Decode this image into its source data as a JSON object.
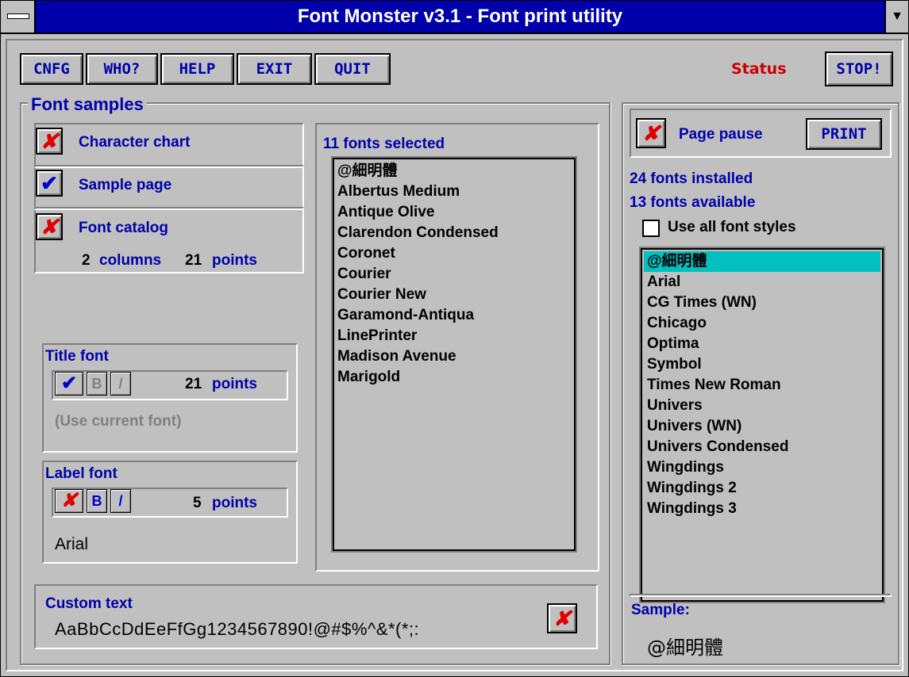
{
  "window": {
    "title": "Font Monster v3.1 - Font print utility"
  },
  "toolbar": {
    "buttons": [
      "CNFG",
      "WHO?",
      "HELP",
      "EXIT",
      "QUIT"
    ],
    "status_label": "Status",
    "stop_label": "STOP!"
  },
  "font_samples": {
    "title": "Font samples",
    "character_chart": {
      "label": "Character chart",
      "state": "x"
    },
    "sample_page": {
      "label": "Sample page",
      "state": "check"
    },
    "font_catalog": {
      "label": "Font catalog",
      "state": "x",
      "columns_value": "2",
      "columns_label": "columns",
      "points_value": "21",
      "points_label": "points"
    }
  },
  "title_font": {
    "title": "Title font",
    "points_value": "21",
    "points_label": "points",
    "hint": "(Use current font)",
    "bold_label": "B",
    "italic_label": "/"
  },
  "label_font": {
    "title": "Label font",
    "points_value": "5",
    "points_label": "points",
    "font_name": "Arial",
    "bold_label": "B",
    "italic_label": "/"
  },
  "selected_fonts": {
    "heading": "11 fonts selected",
    "items": [
      "@細明體",
      "Albertus Medium",
      "Antique Olive",
      "Clarendon Condensed",
      "Coronet",
      "Courier",
      "Courier New",
      "Garamond-Antiqua",
      "LinePrinter",
      "Madison Avenue",
      "Marigold"
    ]
  },
  "custom_text": {
    "label": "Custom text",
    "value": "AaBbCcDdEeFfGg1234567890!@#$%^&*(*;:"
  },
  "right_panel": {
    "page_pause_label": "Page pause",
    "print_label": "PRINT",
    "installed": "24 fonts installed",
    "available": "13 fonts available",
    "use_all_styles": "Use all font styles",
    "fonts": [
      "@細明體",
      "Arial",
      "CG Times (WN)",
      "Chicago",
      "Optima",
      "Symbol",
      "Times New Roman",
      "Univers",
      "Univers (WN)",
      "Univers Condensed",
      "Wingdings",
      "Wingdings 2",
      "Wingdings 3"
    ],
    "selected_index": 0,
    "sample_label": "Sample:",
    "sample_text": "@細明體"
  },
  "icons": {
    "x": "✘",
    "check": "✔"
  },
  "colors": {
    "titlebar": "#0000aa",
    "label": "#0000aa",
    "status": "#cc0000",
    "selection": "#00c0c0",
    "face": "#c0c0c0"
  }
}
